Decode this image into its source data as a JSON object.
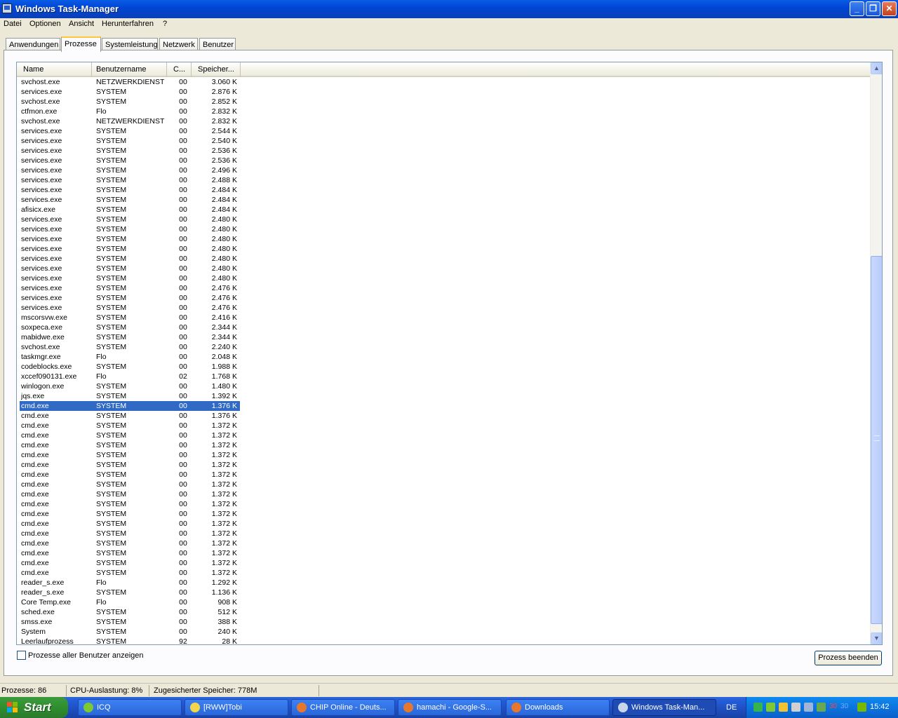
{
  "window": {
    "title": "Windows Task-Manager",
    "minimize": "_",
    "maximize": "❐",
    "close": "✕"
  },
  "menu": [
    "Datei",
    "Optionen",
    "Ansicht",
    "Herunterfahren",
    "?"
  ],
  "tabs": [
    "Anwendungen",
    "Prozesse",
    "Systemleistung",
    "Netzwerk",
    "Benutzer"
  ],
  "active_tab": "Prozesse",
  "columns": [
    "Name",
    "Benutzername",
    "C...",
    "Speicher..."
  ],
  "processes": [
    [
      "svchost.exe",
      "NETZWERKDIENST",
      "00",
      "3.060 K"
    ],
    [
      "services.exe",
      "SYSTEM",
      "00",
      "2.876 K"
    ],
    [
      "svchost.exe",
      "SYSTEM",
      "00",
      "2.852 K"
    ],
    [
      "ctfmon.exe",
      "Flo",
      "00",
      "2.832 K"
    ],
    [
      "svchost.exe",
      "NETZWERKDIENST",
      "00",
      "2.832 K"
    ],
    [
      "services.exe",
      "SYSTEM",
      "00",
      "2.544 K"
    ],
    [
      "services.exe",
      "SYSTEM",
      "00",
      "2.540 K"
    ],
    [
      "services.exe",
      "SYSTEM",
      "00",
      "2.536 K"
    ],
    [
      "services.exe",
      "SYSTEM",
      "00",
      "2.536 K"
    ],
    [
      "services.exe",
      "SYSTEM",
      "00",
      "2.496 K"
    ],
    [
      "services.exe",
      "SYSTEM",
      "00",
      "2.488 K"
    ],
    [
      "services.exe",
      "SYSTEM",
      "00",
      "2.484 K"
    ],
    [
      "services.exe",
      "SYSTEM",
      "00",
      "2.484 K"
    ],
    [
      "afisicx.exe",
      "SYSTEM",
      "00",
      "2.484 K"
    ],
    [
      "services.exe",
      "SYSTEM",
      "00",
      "2.480 K"
    ],
    [
      "services.exe",
      "SYSTEM",
      "00",
      "2.480 K"
    ],
    [
      "services.exe",
      "SYSTEM",
      "00",
      "2.480 K"
    ],
    [
      "services.exe",
      "SYSTEM",
      "00",
      "2.480 K"
    ],
    [
      "services.exe",
      "SYSTEM",
      "00",
      "2.480 K"
    ],
    [
      "services.exe",
      "SYSTEM",
      "00",
      "2.480 K"
    ],
    [
      "services.exe",
      "SYSTEM",
      "00",
      "2.480 K"
    ],
    [
      "services.exe",
      "SYSTEM",
      "00",
      "2.476 K"
    ],
    [
      "services.exe",
      "SYSTEM",
      "00",
      "2.476 K"
    ],
    [
      "services.exe",
      "SYSTEM",
      "00",
      "2.476 K"
    ],
    [
      "mscorsvw.exe",
      "SYSTEM",
      "00",
      "2.416 K"
    ],
    [
      "soxpeca.exe",
      "SYSTEM",
      "00",
      "2.344 K"
    ],
    [
      "mabidwe.exe",
      "SYSTEM",
      "00",
      "2.344 K"
    ],
    [
      "svchost.exe",
      "SYSTEM",
      "00",
      "2.240 K"
    ],
    [
      "taskmgr.exe",
      "Flo",
      "00",
      "2.048 K"
    ],
    [
      "codeblocks.exe",
      "SYSTEM",
      "00",
      "1.988 K"
    ],
    [
      "xccef090131.exe",
      "Flo",
      "02",
      "1.768 K"
    ],
    [
      "winlogon.exe",
      "SYSTEM",
      "00",
      "1.480 K"
    ],
    [
      "jqs.exe",
      "SYSTEM",
      "00",
      "1.392 K"
    ],
    [
      "cmd.exe",
      "SYSTEM",
      "00",
      "1.376 K"
    ],
    [
      "cmd.exe",
      "SYSTEM",
      "00",
      "1.376 K"
    ],
    [
      "cmd.exe",
      "SYSTEM",
      "00",
      "1.372 K"
    ],
    [
      "cmd.exe",
      "SYSTEM",
      "00",
      "1.372 K"
    ],
    [
      "cmd.exe",
      "SYSTEM",
      "00",
      "1.372 K"
    ],
    [
      "cmd.exe",
      "SYSTEM",
      "00",
      "1.372 K"
    ],
    [
      "cmd.exe",
      "SYSTEM",
      "00",
      "1.372 K"
    ],
    [
      "cmd.exe",
      "SYSTEM",
      "00",
      "1.372 K"
    ],
    [
      "cmd.exe",
      "SYSTEM",
      "00",
      "1.372 K"
    ],
    [
      "cmd.exe",
      "SYSTEM",
      "00",
      "1.372 K"
    ],
    [
      "cmd.exe",
      "SYSTEM",
      "00",
      "1.372 K"
    ],
    [
      "cmd.exe",
      "SYSTEM",
      "00",
      "1.372 K"
    ],
    [
      "cmd.exe",
      "SYSTEM",
      "00",
      "1.372 K"
    ],
    [
      "cmd.exe",
      "SYSTEM",
      "00",
      "1.372 K"
    ],
    [
      "cmd.exe",
      "SYSTEM",
      "00",
      "1.372 K"
    ],
    [
      "cmd.exe",
      "SYSTEM",
      "00",
      "1.372 K"
    ],
    [
      "cmd.exe",
      "SYSTEM",
      "00",
      "1.372 K"
    ],
    [
      "cmd.exe",
      "SYSTEM",
      "00",
      "1.372 K"
    ],
    [
      "reader_s.exe",
      "Flo",
      "00",
      "1.292 K"
    ],
    [
      "reader_s.exe",
      "SYSTEM",
      "00",
      "1.136 K"
    ],
    [
      "Core Temp.exe",
      "Flo",
      "00",
      "908 K"
    ],
    [
      "sched.exe",
      "SYSTEM",
      "00",
      "512 K"
    ],
    [
      "smss.exe",
      "SYSTEM",
      "00",
      "388 K"
    ],
    [
      "System",
      "SYSTEM",
      "00",
      "240 K"
    ],
    [
      "Leerlaufprozess",
      "SYSTEM",
      "92",
      "28 K"
    ]
  ],
  "selected_row": 33,
  "show_all_users_label": "Prozesse aller Benutzer anzeigen",
  "end_process_button": "Prozess beenden",
  "status": {
    "processes": "Prozesse: 86",
    "cpu": "CPU-Auslastung: 8%",
    "commit": "Zugesicherter Speicher: 778M"
  },
  "taskbar": {
    "start": "Start",
    "tasks": [
      {
        "label": "ICQ",
        "icon": "icq-icon",
        "color": "#7ec932"
      },
      {
        "label": "[RWW]Tobi",
        "icon": "folder-icon",
        "color": "#f5d64a"
      },
      {
        "label": "CHIP Online - Deuts...",
        "icon": "firefox-icon",
        "color": "#e8772e"
      },
      {
        "label": "hamachi - Google-S...",
        "icon": "firefox-icon",
        "color": "#e8772e"
      },
      {
        "label": "Downloads",
        "icon": "firefox-icon",
        "color": "#e8772e"
      },
      {
        "label": "Windows Task-Man...",
        "icon": "taskmanager-icon",
        "color": "#c9d6ea"
      }
    ],
    "language": "DE",
    "tray_icons": [
      {
        "name": "cpu-monitor-icon",
        "color": "#36b34a"
      },
      {
        "name": "icq-tray-icon",
        "color": "#7ec932"
      },
      {
        "name": "shield-icon",
        "color": "#f1c232"
      },
      {
        "name": "volume-icon",
        "color": "#d0d0d0"
      },
      {
        "name": "network-icon",
        "color": "#9fb4d6"
      },
      {
        "name": "hamachi-icon",
        "color": "#6aa84f"
      }
    ],
    "temps": [
      "30",
      "30"
    ],
    "nvidia_icon_color": "#76b900",
    "clock": "15:42"
  }
}
